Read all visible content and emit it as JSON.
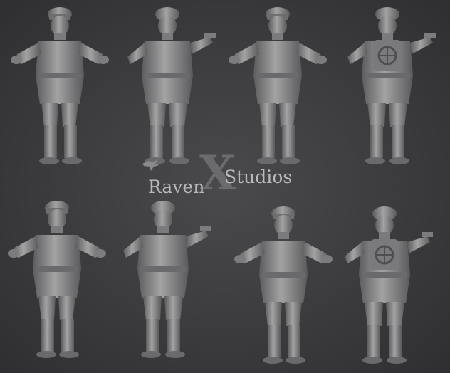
{
  "brand": {
    "x_glyph": "X",
    "left_word": "Raven",
    "right_word": "Studios",
    "crow_icon": "crow-icon"
  },
  "colors": {
    "background": "#3a3a3c",
    "model": "#8e8e8f",
    "model_shadow": "#5c5c5e",
    "model_highlight": "#b4b4b5",
    "logo_text": "#b9b9bb",
    "logo_x": "#6b6b6e"
  },
  "views": [
    {
      "name": "soldier-front-view-1"
    },
    {
      "name": "soldier-back-view-1"
    },
    {
      "name": "soldier-front-view-2"
    },
    {
      "name": "soldier-back-view-backpack-2"
    },
    {
      "name": "soldier-front-view-3"
    },
    {
      "name": "soldier-back-view-rifle-3"
    },
    {
      "name": "soldier-front-view-4"
    },
    {
      "name": "soldier-back-view-backpack-4"
    }
  ]
}
